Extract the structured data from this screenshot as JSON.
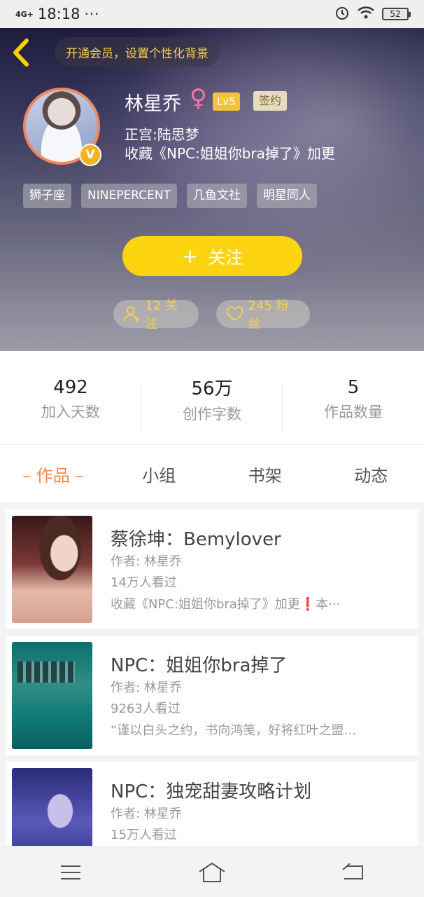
{
  "status_bar": {
    "network": "4G+",
    "time": "18:18",
    "dots": "···",
    "battery": "52"
  },
  "header": {
    "vip_banner": "开通会员，设置个性化背景",
    "name": "林星乔",
    "gender_symbol": "♀",
    "level": "Lv5",
    "sign_badge": "签约",
    "info_line1": "正宫:陆思梦",
    "info_line2": "收藏《NPC:姐姐你bra掉了》加更",
    "verified_mark": "V",
    "tags": [
      "狮子座",
      "NINEPERCENT",
      "几鱼文社",
      "明星同人"
    ],
    "follow_button": {
      "plus": "+",
      "label": "关注"
    },
    "following_pill": "12 关注",
    "fans_pill": "245 粉丝",
    "accent_color": "#fbd40f"
  },
  "stats": [
    {
      "value": "492",
      "label": "加入天数"
    },
    {
      "value": "56万",
      "label": "创作字数"
    },
    {
      "value": "5",
      "label": "作品数量"
    }
  ],
  "tabs": [
    {
      "label": "– 作品 –",
      "active": true
    },
    {
      "label": "小组",
      "active": false
    },
    {
      "label": "书架",
      "active": false
    },
    {
      "label": "动态",
      "active": false
    }
  ],
  "works": [
    {
      "title": "蔡徐坤：Bemylover",
      "author": "作者: 林星乔",
      "views": "14万人看过",
      "desc": "收藏《NPC:姐姐你bra掉了》加更❗本···"
    },
    {
      "title": "NPC：姐姐你bra掉了",
      "author": "作者: 林星乔",
      "views": "9263人看过",
      "desc": "“谨以白头之约，书向鸿笺，好将红叶之盟…"
    },
    {
      "title": "NPC：独宠甜妻攻略计划",
      "author": "作者: 林星乔",
      "views": "15万人看过",
      "desc": ""
    }
  ]
}
